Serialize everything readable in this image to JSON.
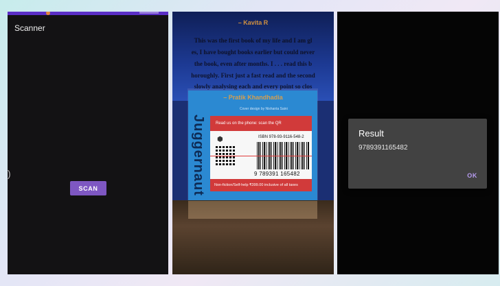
{
  "screen1": {
    "app_title": "Scanner",
    "scan_button_label": "SCAN",
    "edge_glyph": ")"
  },
  "screen2": {
    "page_lines": [
      "This was the first book of my life and I am gl",
      "es, I have bought books earlier but could never",
      "the book, even after months. I . . . read this b",
      "horoughly. First just a fast read and the second",
      "slowly analysing each and every point so clos"
    ],
    "author_top": "– Kavita R",
    "author_bottom": "– Pratik Khandhadia",
    "cover_credit": "Cover design by Nishanta Saini",
    "label_header": "Read us on the phone: scan the QR",
    "isbn_text": "ISBN 978-93-9116-548-2",
    "barcode_digits": "9 789391 165482",
    "label_footer": "Non-fiction/Self-help ₹399.00 inclusive of all taxes",
    "brand": "Juggernaut"
  },
  "screen3": {
    "dialog_title": "Result",
    "dialog_message": "9789391165482",
    "ok_label": "OK"
  },
  "colors": {
    "accent_purple": "#7e57c2",
    "status_bar": "#5b2fc7",
    "ok_text": "#b79cf2",
    "dialog_bg": "#424242"
  }
}
